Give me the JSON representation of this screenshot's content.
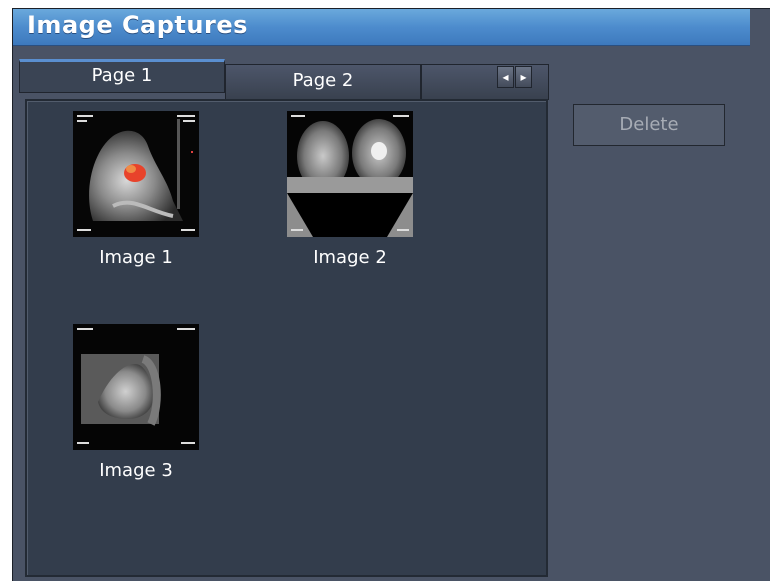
{
  "window": {
    "title": "Image Captures"
  },
  "tabs": [
    {
      "label": "Page 1",
      "active": true
    },
    {
      "label": "Page 2",
      "active": false
    },
    {
      "label": "",
      "active": false
    }
  ],
  "nav": {
    "prev_icon": "chevron-left-icon",
    "next_icon": "chevron-right-icon",
    "prev_glyph": "◂",
    "next_glyph": "▸"
  },
  "images": [
    {
      "label": "Image 1"
    },
    {
      "label": "Image 2"
    },
    {
      "label": "Image 3"
    }
  ],
  "actions": {
    "delete_label": "Delete"
  },
  "colors": {
    "title_bar": "#4d8ccd",
    "background": "#4a5365",
    "panel": "#333d4c",
    "overlay": "#e8432b"
  }
}
